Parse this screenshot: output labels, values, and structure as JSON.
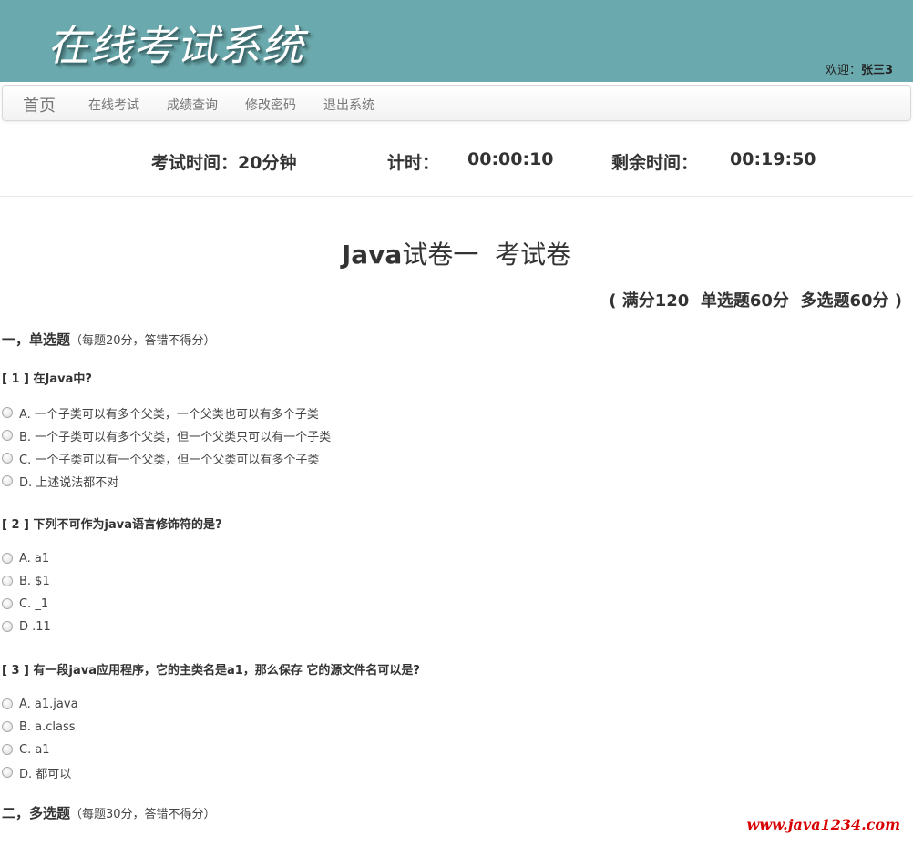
{
  "header": {
    "title": "在线考试系统",
    "welcome_label": "欢迎：",
    "username": "张三3"
  },
  "navbar": {
    "brand": "首页",
    "items": [
      "在线考试",
      "成绩查询",
      "修改密码",
      "退出系统"
    ]
  },
  "timer": {
    "duration_label": "考试时间：20分钟",
    "elapsed_label": "计时：",
    "elapsed_value": "00:00:10",
    "remaining_label": "剩余时间：",
    "remaining_value": "00:19:50"
  },
  "paper": {
    "title_latin": "Java",
    "title_rest": "试卷一  考试卷",
    "score_info": "( 满分120  单选题60分  多选题60分 )"
  },
  "sections": [
    {
      "title": "一，单选题",
      "note": "（每题20分，答错不得分）",
      "questions": [
        {
          "stem": "[ 1 ] 在Java中?",
          "options": [
            "A. 一个子类可以有多个父类，一个父类也可以有多个子类",
            "B. 一个子类可以有多个父类，但一个父类只可以有一个子类",
            "C. 一个子类可以有一个父类，但一个父类可以有多个子类",
            "D. 上述说法都不对"
          ]
        },
        {
          "stem": "[ 2 ] 下列不可作为java语言修饰符的是?",
          "options": [
            "A. a1",
            "B. $1",
            "C. _1",
            "D .11"
          ]
        },
        {
          "stem": "[ 3 ] 有一段java应用程序，它的主类名是a1，那么保存 它的源文件名可以是?",
          "options": [
            "A. a1.java",
            "B. a.class",
            "C. a1",
            "D. 都可以"
          ]
        }
      ]
    },
    {
      "title": "二，多选题",
      "note": "（每题30分，答错不得分）"
    }
  ],
  "watermark": "www.java1234.com",
  "colors": {
    "banner": "#6aa9ad",
    "watermark": "#d80000"
  }
}
